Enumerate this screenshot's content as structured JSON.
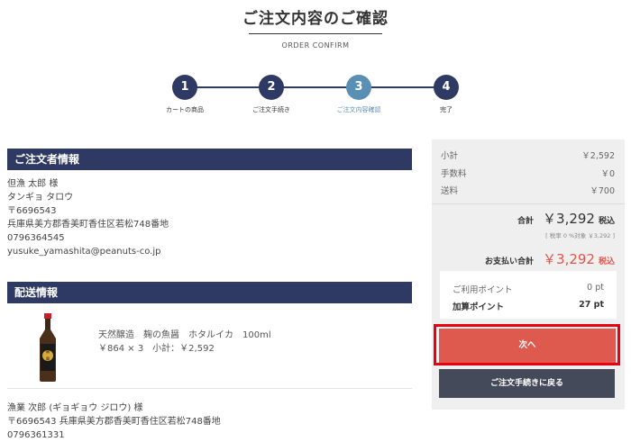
{
  "header": {
    "title": "ご注文内容のご確認",
    "subtitle": "ORDER CONFIRM"
  },
  "steps": [
    {
      "number": "1",
      "label": "カートの商品"
    },
    {
      "number": "2",
      "label": "ご注文手続き"
    },
    {
      "number": "3",
      "label": "ご注文内容確認"
    },
    {
      "number": "4",
      "label": "完了"
    }
  ],
  "current_step": 3,
  "orderer": {
    "heading": "ご注文者情報",
    "name": "但漁 太郎 様",
    "kana": "タンギョ タロウ",
    "postal": "〒6696543",
    "address": "兵庫県美方郡香美町香住区若松748番地",
    "phone": "0796364545",
    "email": "yusuke_yamashita@peanuts-co.jp"
  },
  "shipping": {
    "heading": "配送情報",
    "product": {
      "name": "天然醸造　麹の魚醤　ホタルイカ　100ml",
      "price_line": "￥864 × 3　小計：￥2,592",
      "bottle_label": "麹の魚醤"
    },
    "recipient_name": "漁業 次郎 (ギョギョウ ジロウ) 様",
    "recipient_address": "〒6696543 兵庫県美方郡香美町香住区若松748番地",
    "recipient_phone_partial": "0796361331"
  },
  "summary": {
    "subtotal_label": "小計",
    "subtotal_value": "￥2,592",
    "fee_label": "手数料",
    "fee_value": "￥0",
    "shipping_label": "送料",
    "shipping_value": "￥700",
    "total_label": "合計",
    "total_value": "￥3,292",
    "tax_included": "税込",
    "tax_note": "[ 税率 0 %対象 ￥3,292 ]",
    "payment_label": "お支払い合計",
    "payment_value": "￥3,292",
    "used_points_label": "ご利用ポイント",
    "used_points_value": "0 pt",
    "added_points_label": "加算ポイント",
    "added_points_value": "27 pt"
  },
  "buttons": {
    "next": "次へ",
    "back": "ご注文手続きに戻る"
  },
  "colors": {
    "navy": "#2e3a63",
    "current_step": "#5a8fb4",
    "next_button": "#df5a4e",
    "highlight_outline": "#e60012",
    "back_button": "#444a59",
    "price_red": "#e0554b"
  }
}
